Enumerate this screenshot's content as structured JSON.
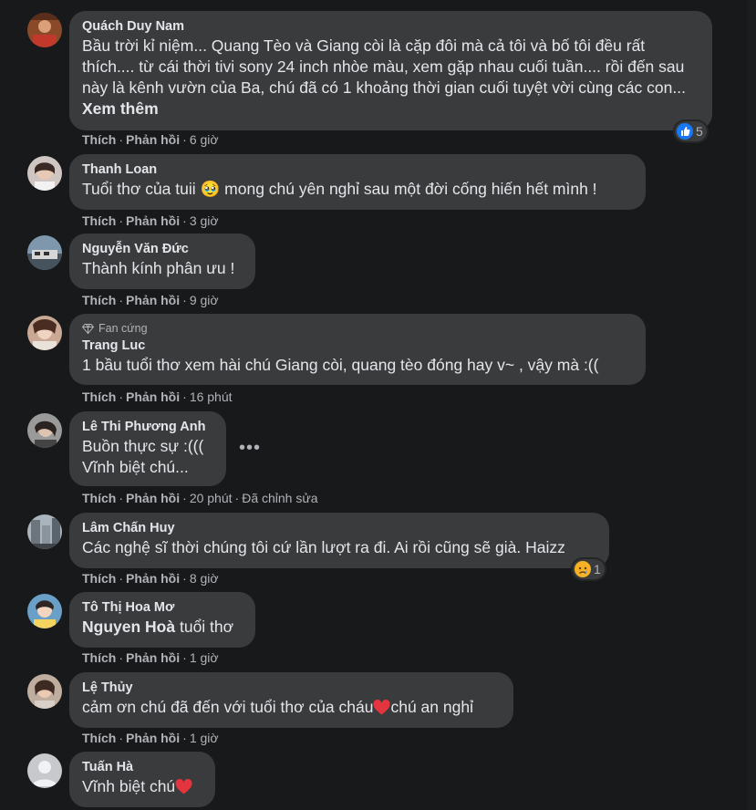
{
  "comments": [
    {
      "author": "Quách Duy Nam",
      "text": "Bầu trời kỉ niệm... Quang Tèo và Giang còi là cặp đôi mà cả tôi và bố tôi đều rất thích.... từ cái thời tivi sony 24 inch nhòe màu, xem gặp nhau cuối tuần.... rồi đến sau này là kênh vườn của Ba, chú đã có 1 khoảng thời gian cuối tuyệt vời cùng các con... ",
      "see_more": "Xem thêm",
      "like": "Thích",
      "reply": "Phản hồi",
      "time": "6 giờ",
      "reaction_count": "5"
    },
    {
      "author": "Thanh Loan",
      "text_before": "Tuổi thơ của tuii ",
      "emoji": "🥹",
      "text_after": " mong chú yên nghỉ sau một đời cống hiến hết mình !",
      "like": "Thích",
      "reply": "Phản hồi",
      "time": "3 giờ"
    },
    {
      "author": "Nguyễn Văn Đức",
      "text": "Thành kính phân ưu !",
      "like": "Thích",
      "reply": "Phản hồi",
      "time": "9 giờ"
    },
    {
      "badge": "Fan cứng",
      "author": "Trang Luc",
      "text": "1 bầu tuổi thơ xem hài chú Giang còi, quang tèo đóng hay v~ , vậy mà :((",
      "like": "Thích",
      "reply": "Phản hồi",
      "time": "16 phút"
    },
    {
      "author": "Lê Thi Phương Anh",
      "line1": "Buồn thực sự :(((",
      "line2": "Vĩnh biệt chú...",
      "like": "Thích",
      "reply": "Phản hồi",
      "time": "20 phút",
      "edited": "Đã chỉnh sửa",
      "more": "•••"
    },
    {
      "author": "Lâm Chấn Huy",
      "text": "Các nghệ sĩ thời chúng tôi cứ lần lượt ra đi. Ai rồi cũng sẽ già. Haizz",
      "like": "Thích",
      "reply": "Phản hồi",
      "time": "8 giờ",
      "reaction_count": "1"
    },
    {
      "author": "Tô Thị Hoa Mơ",
      "mention": "Nguyen Hoà",
      "text": " tuổi thơ",
      "like": "Thích",
      "reply": "Phản hồi",
      "time": "1 giờ"
    },
    {
      "author": "Lệ Thủy",
      "text_before": "cảm ơn chú đã đến với tuổi thơ của cháu",
      "text_after": "chú an nghỉ",
      "like": "Thích",
      "reply": "Phản hồi",
      "time": "1 giờ"
    },
    {
      "author": "Tuấn Hà",
      "text_before": "Vĩnh biệt chú",
      "text_after": ""
    }
  ],
  "colors": {
    "background": "#18191a",
    "bubble": "#3a3b3c",
    "primary_text": "#e4e6eb",
    "secondary_text": "#b0b3b8",
    "like_blue": "#1877f2",
    "heart_red": "#e4343e"
  },
  "icons": [
    "like-reaction-icon",
    "sad-reaction-icon",
    "diamond-badge-icon",
    "heart-emoji-icon",
    "more-options-icon"
  ]
}
